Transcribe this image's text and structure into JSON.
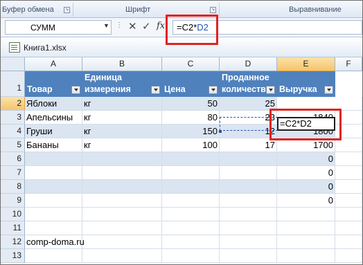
{
  "ribbon": {
    "groups": [
      "Буфер обмена",
      "Шрифт",
      "Выравнивание"
    ]
  },
  "formula_bar": {
    "name_box": "СУММ",
    "formula_prefix": "=C2*",
    "formula_ref": "D2"
  },
  "workbook": {
    "title": "Книга1.xlsx"
  },
  "sheet": {
    "columns": [
      "A",
      "B",
      "C",
      "D",
      "E",
      "F"
    ],
    "rows": [
      "1",
      "2",
      "3",
      "4",
      "5",
      "6",
      "7",
      "8",
      "9",
      "10",
      "11",
      "12",
      "13"
    ],
    "headers": {
      "a": "Товар",
      "b_line1": "Единица",
      "b_line2": "измерения",
      "c": "Цена",
      "d_line1": "Проданное",
      "d_line2": "количество",
      "e": "Выручка"
    },
    "data": [
      {
        "a": "Яблоки",
        "b": "кг",
        "c": "50",
        "d": "25",
        "e": "=C2*D2"
      },
      {
        "a": "Апельсины",
        "b": "кг",
        "c": "80",
        "d": "23",
        "e": "1840"
      },
      {
        "a": "Груши",
        "b": "кг",
        "c": "150",
        "d": "12",
        "e": "1800"
      },
      {
        "a": "Бананы",
        "b": "кг",
        "c": "100",
        "d": "17",
        "e": "1700"
      },
      {
        "a": "",
        "b": "",
        "c": "",
        "d": "",
        "e": "0"
      },
      {
        "a": "",
        "b": "",
        "c": "",
        "d": "",
        "e": "0"
      },
      {
        "a": "",
        "b": "",
        "c": "",
        "d": "",
        "e": "0"
      },
      {
        "a": "",
        "b": "",
        "c": "",
        "d": "",
        "e": "0"
      }
    ],
    "footer_text": "comp-doma.ru"
  },
  "colors": {
    "table_header": "#4f81bd",
    "band": "#dbe5f1",
    "highlight": "#e0231f"
  }
}
